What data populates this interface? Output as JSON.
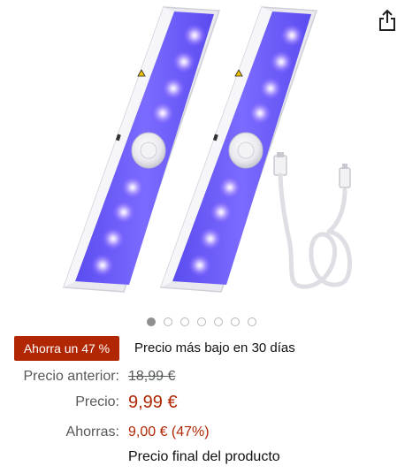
{
  "header": {
    "share_icon": "share-icon"
  },
  "product": {
    "image_alt": "Two UV LED light bars with motion sensor and a USB charging cable"
  },
  "carousel": {
    "dot_count": 7,
    "active_index": 0
  },
  "deal": {
    "badge_text": "Ahorra un 47 %",
    "note": "Precio más bajo en 30 días"
  },
  "pricing": {
    "previous_label": "Precio anterior:",
    "previous_value": "18,99 €",
    "price_label": "Precio:",
    "price_value": "9,99 €",
    "savings_label": "Ahorras:",
    "savings_value": "9,00 € (47%)",
    "final_note": "Precio final del producto"
  },
  "colors": {
    "deal_red": "#b12704",
    "muted_text": "#565959",
    "uv_purple": "#6a4cff"
  }
}
